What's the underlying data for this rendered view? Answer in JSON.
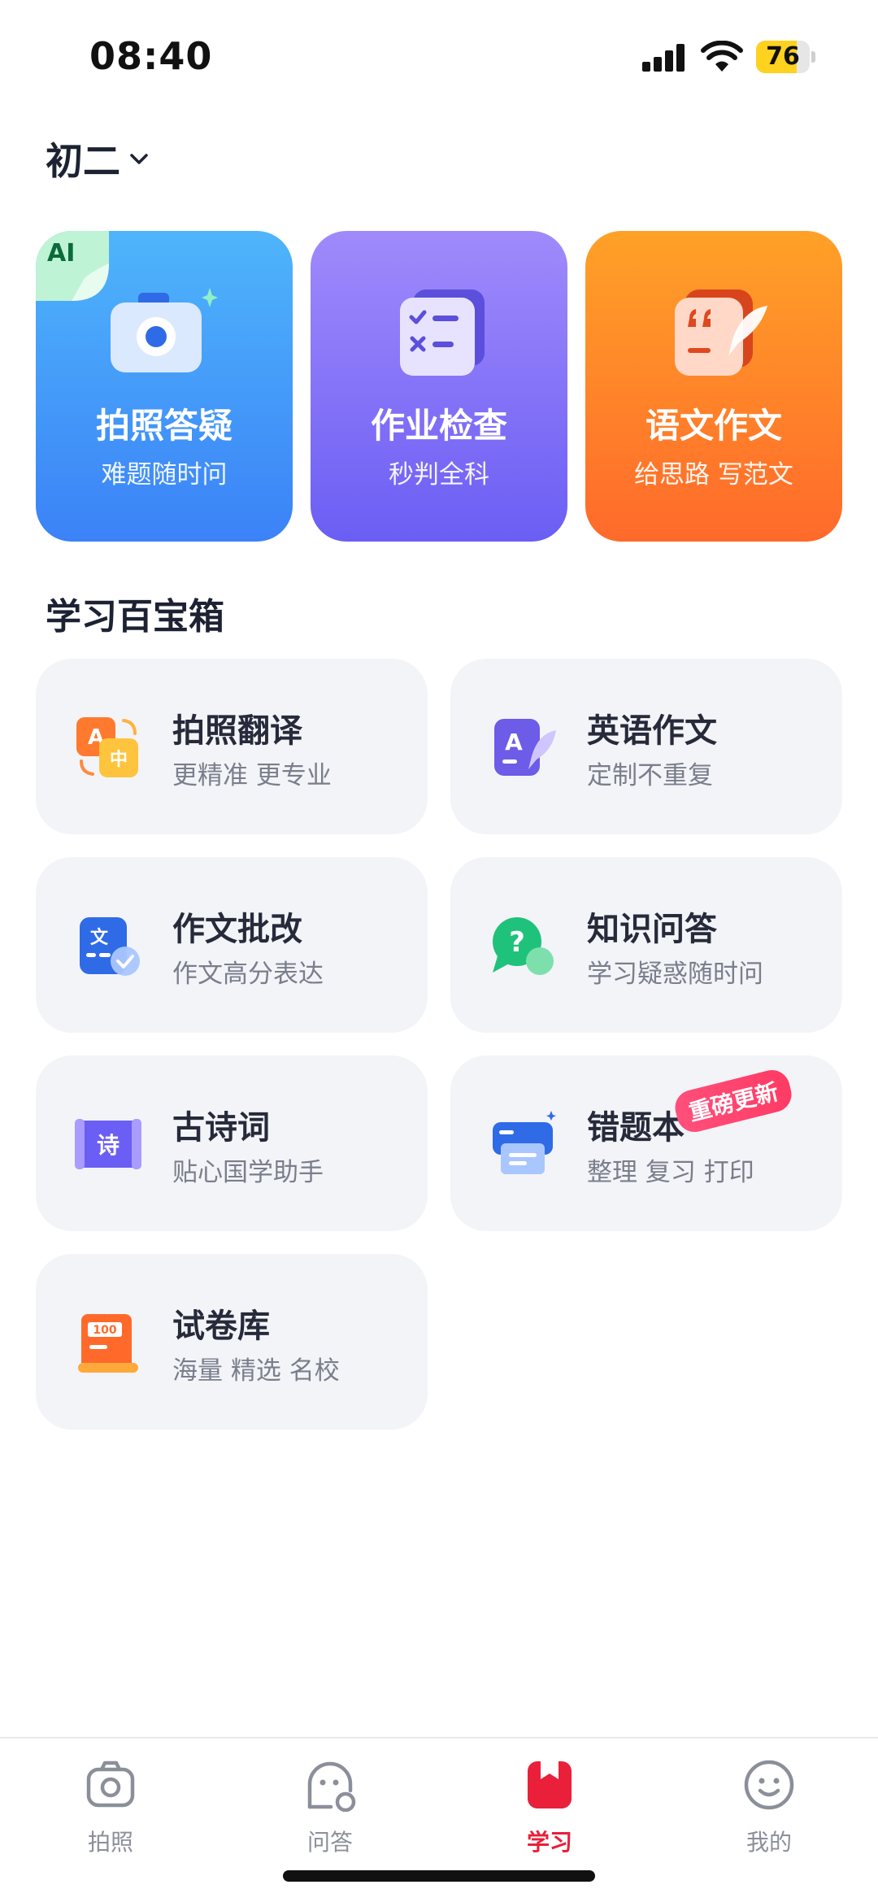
{
  "status": {
    "time": "08:40",
    "battery": "76"
  },
  "grade": {
    "label": "初二"
  },
  "features": [
    {
      "title": "拍照答疑",
      "subtitle": "难题随时问",
      "badge": "AI"
    },
    {
      "title": "作业检查",
      "subtitle": "秒判全科"
    },
    {
      "title": "语文作文",
      "subtitle": "给思路 写范文"
    }
  ],
  "section": {
    "title": "学习百宝箱"
  },
  "tools": [
    {
      "title": "拍照翻译",
      "subtitle": "更精准 更专业"
    },
    {
      "title": "英语作文",
      "subtitle": "定制不重复"
    },
    {
      "title": "作文批改",
      "subtitle": "作文高分表达"
    },
    {
      "title": "知识问答",
      "subtitle": "学习疑惑随时问"
    },
    {
      "title": "古诗词",
      "subtitle": "贴心国学助手"
    },
    {
      "title": "错题本",
      "subtitle": "整理 复习 打印",
      "badge": "重磅更新"
    },
    {
      "title": "试卷库",
      "subtitle": "海量 精选 名校"
    }
  ],
  "tabs": [
    {
      "label": "拍照",
      "icon": "camera-icon"
    },
    {
      "label": "问答",
      "icon": "chat-bot-icon"
    },
    {
      "label": "学习",
      "icon": "bookmark-book-icon",
      "active": true
    },
    {
      "label": "我的",
      "icon": "smile-face-icon"
    }
  ],
  "colors": {
    "active_tab": "#ea1f3a",
    "tile_bg": "#f3f4f8"
  }
}
